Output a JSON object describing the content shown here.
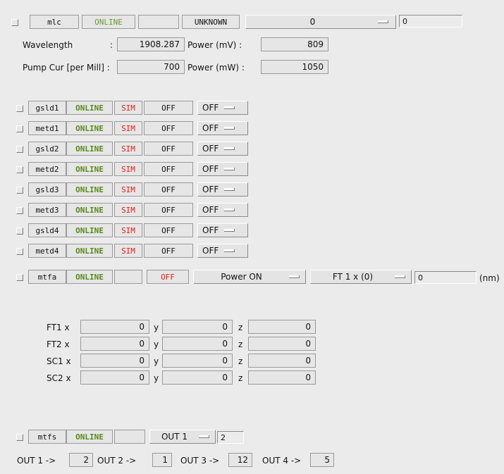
{
  "mlc": {
    "name": "mlc",
    "status": "ONLINE",
    "extra": "",
    "state": "UNKNOWN",
    "menu_value": "0",
    "input_value": "0",
    "wavelength_label": "Wavelength",
    "wavelength_colon": ":",
    "wavelength_value": "1908.287",
    "power_mv_label": "Power (mV) :",
    "power_mv_value": "809",
    "pump_label": "Pump Cur [per Mill] :",
    "pump_value": "700",
    "power_mw_label": "Power (mW) :",
    "power_mw_value": "1050"
  },
  "devices": [
    {
      "name": "gsld1",
      "status": "ONLINE",
      "sim": "SIM",
      "state": "OFF",
      "menu": "OFF"
    },
    {
      "name": "metd1",
      "status": "ONLINE",
      "sim": "SIM",
      "state": "OFF",
      "menu": "OFF"
    },
    {
      "name": "gsld2",
      "status": "ONLINE",
      "sim": "SIM",
      "state": "OFF",
      "menu": "OFF"
    },
    {
      "name": "metd2",
      "status": "ONLINE",
      "sim": "SIM",
      "state": "OFF",
      "menu": "OFF"
    },
    {
      "name": "gsld3",
      "status": "ONLINE",
      "sim": "SIM",
      "state": "OFF",
      "menu": "OFF"
    },
    {
      "name": "metd3",
      "status": "ONLINE",
      "sim": "SIM",
      "state": "OFF",
      "menu": "OFF"
    },
    {
      "name": "gsld4",
      "status": "ONLINE",
      "sim": "SIM",
      "state": "OFF",
      "menu": "OFF"
    },
    {
      "name": "metd4",
      "status": "ONLINE",
      "sim": "SIM",
      "state": "OFF",
      "menu": "OFF"
    }
  ],
  "mtfa": {
    "name": "mtfa",
    "status": "ONLINE",
    "extra": "",
    "state": "OFF",
    "power_menu": "Power ON",
    "axis_menu": "FT 1 x (0)",
    "input_value": "0",
    "unit": "(nm)"
  },
  "positions": [
    {
      "label": "FT1 x",
      "x": "0",
      "y_label": "y",
      "y": "0",
      "z_label": "z",
      "z": "0"
    },
    {
      "label": "FT2 x",
      "x": "0",
      "y_label": "y",
      "y": "0",
      "z_label": "z",
      "z": "0"
    },
    {
      "label": "SC1 x",
      "x": "0",
      "y_label": "y",
      "y": "0",
      "z_label": "z",
      "z": "0"
    },
    {
      "label": "SC2 x",
      "x": "0",
      "y_label": "y",
      "y": "0",
      "z_label": "z",
      "z": "0"
    }
  ],
  "mtfs": {
    "name": "mtfs",
    "status": "ONLINE",
    "extra": "",
    "out_menu": "OUT 1",
    "input_value": "2",
    "outs": [
      {
        "label": "OUT 1 ->",
        "value": "2"
      },
      {
        "label": "OUT 2 ->",
        "value": "1"
      },
      {
        "label": "OUT 3 ->",
        "value": "12"
      },
      {
        "label": "OUT 4 ->",
        "value": "5"
      }
    ]
  },
  "colors": {
    "background": "#ebebeb",
    "online_green": "#5a8a1e",
    "alarm_red": "#e0201a"
  }
}
